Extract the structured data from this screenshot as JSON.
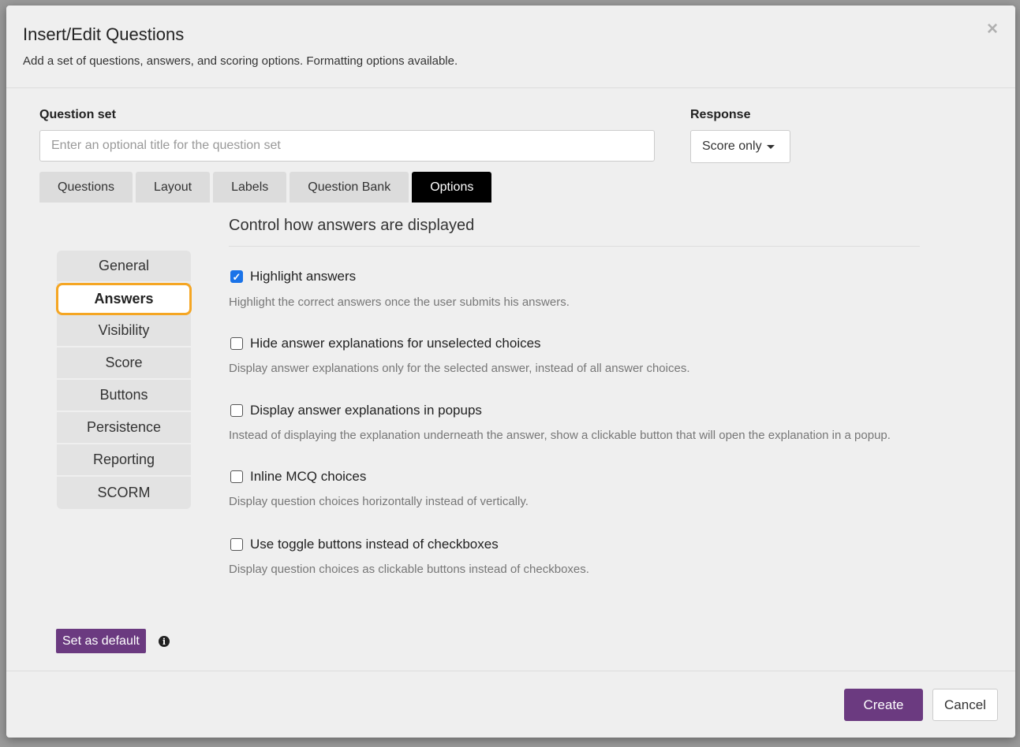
{
  "dialog": {
    "title": "Insert/Edit Questions",
    "subtitle": "Add a set of questions, answers, and scoring options. Formatting options available.",
    "close_glyph": "×"
  },
  "question_set": {
    "label": "Question set",
    "value": "",
    "placeholder": "Enter an optional title for the question set"
  },
  "response": {
    "label": "Response",
    "selected": "Score only"
  },
  "tabs": [
    {
      "label": "Questions",
      "active": false
    },
    {
      "label": "Layout",
      "active": false
    },
    {
      "label": "Labels",
      "active": false
    },
    {
      "label": "Question Bank",
      "active": false
    },
    {
      "label": "Options",
      "active": true
    }
  ],
  "sidebar": {
    "items": [
      {
        "label": "General",
        "active": false
      },
      {
        "label": "Answers",
        "active": true
      },
      {
        "label": "Visibility",
        "active": false
      },
      {
        "label": "Score",
        "active": false
      },
      {
        "label": "Buttons",
        "active": false
      },
      {
        "label": "Persistence",
        "active": false
      },
      {
        "label": "Reporting",
        "active": false
      },
      {
        "label": "SCORM",
        "active": false
      }
    ]
  },
  "section": {
    "heading": "Control how answers are displayed"
  },
  "options": [
    {
      "label": "Highlight answers",
      "checked": true,
      "description": "Highlight the correct answers once the user submits his answers."
    },
    {
      "label": "Hide answer explanations for unselected choices",
      "checked": false,
      "description": "Display answer explanations only for the selected answer, instead of all answer choices."
    },
    {
      "label": "Display answer explanations in popups",
      "checked": false,
      "description": "Instead of displaying the explanation underneath the answer, show a clickable button that will open the explanation in a popup."
    },
    {
      "label": "Inline MCQ choices",
      "checked": false,
      "description": "Display question choices horizontally instead of vertically."
    },
    {
      "label": "Use toggle buttons instead of checkboxes",
      "checked": false,
      "description": "Display question choices as clickable buttons instead of checkboxes."
    }
  ],
  "footer": {
    "set_default_label": "Set as default",
    "info_glyph": "i",
    "create_label": "Create",
    "cancel_label": "Cancel"
  },
  "colors": {
    "primary_purple": "#6b3a80",
    "active_tab": "#000000",
    "checkbox_checked": "#1a73e8",
    "highlight_outline": "#f5a623"
  }
}
